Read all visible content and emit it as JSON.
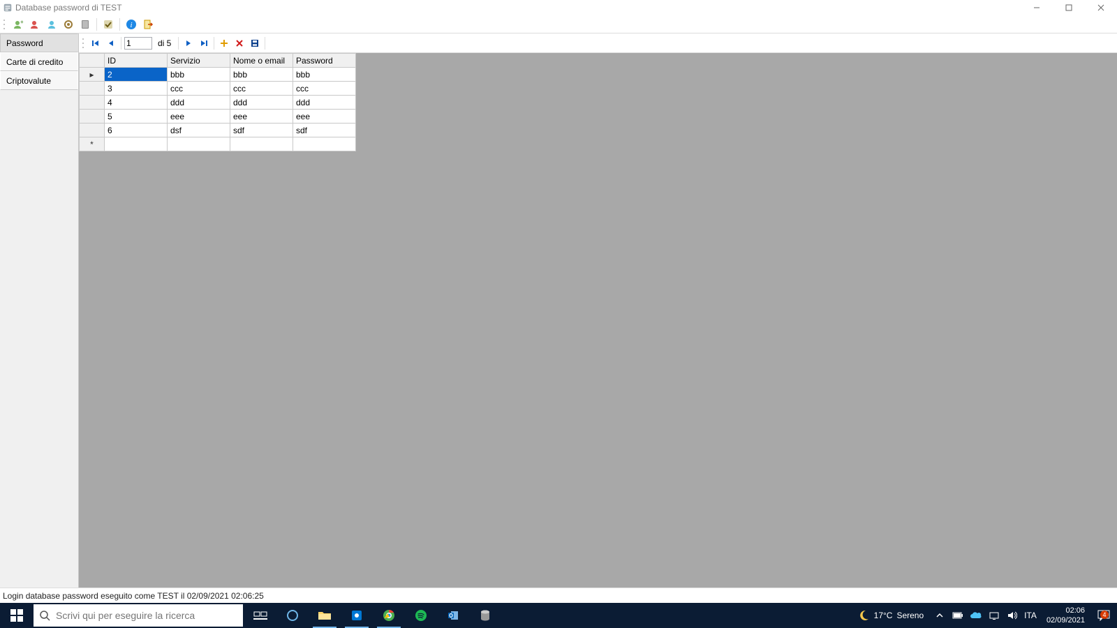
{
  "window": {
    "title": "Database password di TEST"
  },
  "toolbar": {},
  "sidebar": {
    "items": [
      {
        "label": "Password",
        "selected": true
      },
      {
        "label": "Carte di credito",
        "selected": false
      },
      {
        "label": "Criptovalute",
        "selected": false
      }
    ]
  },
  "navigator": {
    "position": "1",
    "count_label": "di 5"
  },
  "grid": {
    "columns": [
      "ID",
      "Servizio",
      "Nome o email",
      "Password"
    ],
    "rows": [
      {
        "id": "2",
        "servizio": "bbb",
        "nome": "bbb",
        "password": "bbb",
        "current": true
      },
      {
        "id": "3",
        "servizio": "ccc",
        "nome": "ccc",
        "password": "ccc",
        "current": false
      },
      {
        "id": "4",
        "servizio": "ddd",
        "nome": "ddd",
        "password": "ddd",
        "current": false
      },
      {
        "id": "5",
        "servizio": "eee",
        "nome": "eee",
        "password": "eee",
        "current": false
      },
      {
        "id": "6",
        "servizio": "dsf",
        "nome": "sdf",
        "password": "sdf",
        "current": false
      }
    ],
    "new_row_marker": "*"
  },
  "status": {
    "text": "Login database password eseguito come TEST il 02/09/2021 02:06:25"
  },
  "taskbar": {
    "search_placeholder": "Scrivi qui per eseguire la ricerca",
    "weather": {
      "temp": "17°C",
      "desc": "Sereno"
    },
    "lang": "ITA",
    "time": "02:06",
    "date": "02/09/2021",
    "notif_count": "4"
  }
}
